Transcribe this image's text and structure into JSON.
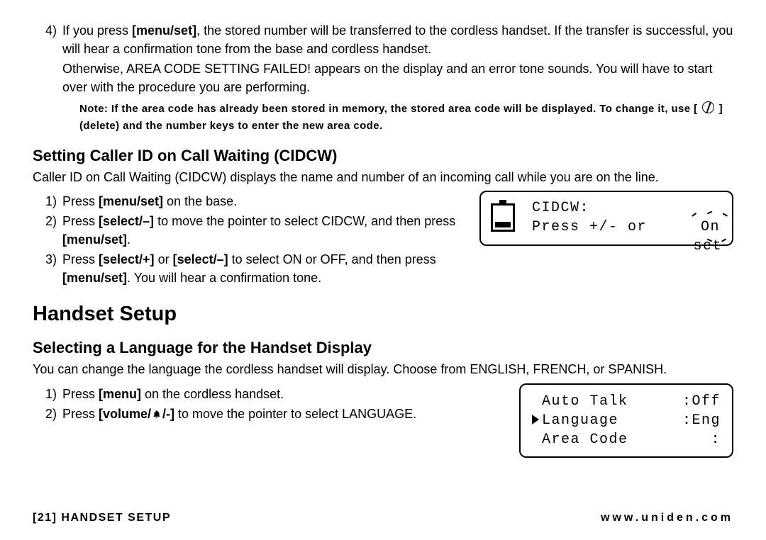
{
  "intro": {
    "step4_num": "4)",
    "step4_p1a": "If you press ",
    "step4_bold1": "[menu/set]",
    "step4_p1b": ", the stored number will be transferred to the cordless handset. If the transfer is successful, you will hear a confirmation tone from the base and cordless handset.",
    "step4_p2": "Otherwise, AREA CODE SETTING FAILED! appears on the display and an error tone sounds. You will have to start over with the procedure you are performing.",
    "note_a": "Note:  If the area code has already been stored in memory, the stored area code will be displayed. To change it, use [ ",
    "note_b": " ] (delete) and the number keys to enter the new area code."
  },
  "cidcw": {
    "heading": "Setting Caller ID on Call Waiting (CIDCW)",
    "para": "Caller ID on Call Waiting (CIDCW) displays the name and number of an incoming call while you are on the line.",
    "s1_num": "1)",
    "s1a": "Press ",
    "s1bold": "[menu/set]",
    "s1b": " on the base.",
    "s2_num": "2)",
    "s2a": "Press ",
    "s2bold1": "[select/–]",
    "s2b": " to move the pointer to select CIDCW, and then press ",
    "s2bold2": "[menu/set]",
    "s2c": ".",
    "s3_num": "3)",
    "s3a": "Press ",
    "s3bold1": "[select/+]",
    "s3b": " or ",
    "s3bold2": "[select/–]",
    "s3c": "  to select ON or OFF, and then press ",
    "s3bold3": "[menu/set]",
    "s3d": ". You will hear a confirmation tone.",
    "lcd_line1": "CIDCW:",
    "lcd_line2_left": "Press +/- or",
    "lcd_line2_right": "On",
    "lcd_line2_tail": "set"
  },
  "handset": {
    "h1": "Handset Setup",
    "h2": "Selecting a Language for the Handset Display",
    "para": "You can change the language the cordless handset will display. Choose from ENGLISH, FRENCH, or SPANISH.",
    "s1_num": "1)",
    "s1a": "Press ",
    "s1bold": "[menu]",
    "s1b": " on the cordless handset.",
    "s2_num": "2)",
    "s2a": "Press ",
    "s2bold": "[volume/",
    "s2tail": "/-]",
    "s2b": " to move the pointer to select LANGUAGE.",
    "lcd_r1_l": "Auto Talk",
    "lcd_r1_r": ":Off",
    "lcd_r2_l": "Language",
    "lcd_r2_r": ":Eng",
    "lcd_r3_l": "Area Code",
    "lcd_r3_r": ":"
  },
  "footer": {
    "left": "[21] HANDSET SETUP",
    "right": "www.uniden.com"
  }
}
